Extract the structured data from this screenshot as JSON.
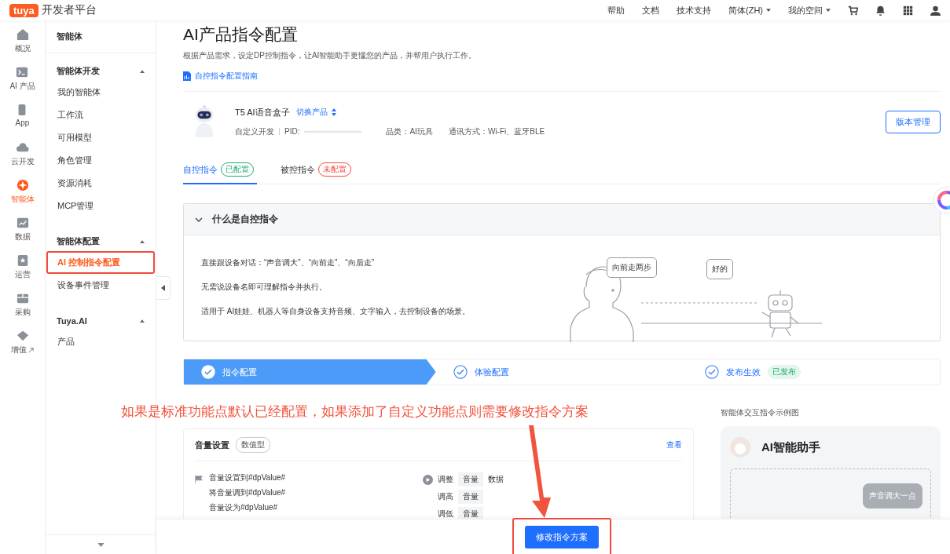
{
  "header": {
    "logo": "tuya",
    "title": "开发者平台",
    "links": [
      {
        "label": "帮助",
        "dropdown": false
      },
      {
        "label": "文档",
        "dropdown": false
      },
      {
        "label": "技术支持",
        "dropdown": false
      },
      {
        "label": "简体(ZH)",
        "dropdown": true
      },
      {
        "label": "我的空间",
        "dropdown": true
      }
    ]
  },
  "rail": [
    {
      "label": "概况",
      "selected": false,
      "external": false
    },
    {
      "label": "AI 产品",
      "selected": false,
      "external": false
    },
    {
      "label": "App",
      "selected": false,
      "external": false
    },
    {
      "label": "云开发",
      "selected": false,
      "external": false
    },
    {
      "label": "智能体",
      "selected": true,
      "external": false
    },
    {
      "label": "数据",
      "selected": false,
      "external": false
    },
    {
      "label": "运营",
      "selected": false,
      "external": false
    },
    {
      "label": "采购",
      "selected": false,
      "external": false
    },
    {
      "label": "增值",
      "selected": false,
      "external": true
    }
  ],
  "sidebar": {
    "title": "智能体",
    "groups": [
      {
        "label": "智能体开发",
        "expanded": true,
        "items": [
          {
            "label": "我的智能体",
            "selected": false,
            "highlighted": false
          },
          {
            "label": "工作流",
            "selected": false,
            "highlighted": false
          },
          {
            "label": "可用模型",
            "selected": false,
            "highlighted": false
          },
          {
            "label": "角色管理",
            "selected": false,
            "highlighted": false
          },
          {
            "label": "资源消耗",
            "selected": false,
            "highlighted": false
          },
          {
            "label": "MCP管理",
            "selected": false,
            "highlighted": false
          }
        ]
      },
      {
        "label": "智能体配置",
        "expanded": true,
        "items": [
          {
            "label": "AI 控制指令配置",
            "selected": true,
            "highlighted": true
          },
          {
            "label": "设备事件管理",
            "selected": false,
            "highlighted": false
          }
        ]
      },
      {
        "label": "Tuya.AI",
        "expanded": true,
        "items": [
          {
            "label": "产品",
            "selected": false,
            "highlighted": false
          }
        ]
      }
    ]
  },
  "page": {
    "title": "AI产品指令配置",
    "description": "根据产品需求，设定DP控制指令，让AI智能助手更懂您的产品，并帮用户执行工作。",
    "guide_link": "自控指令配置指南"
  },
  "product": {
    "name": "T5 AI语音盒子",
    "switch": "切换产品",
    "dev_type": "自定义开发",
    "pid_label": "PID:",
    "category": "品类：AI玩具",
    "connectivity": "通讯方式：Wi-Fi、蓝牙BLE",
    "version_button": "版本管理"
  },
  "tabs": [
    {
      "label": "自控指令",
      "selected": true,
      "badge": "已配置",
      "color": "#1fa971"
    },
    {
      "label": "被控指令",
      "selected": false,
      "badge": "未配置",
      "color": "#f04a3e"
    }
  ],
  "intro": {
    "title": "什么是自控指令",
    "expanded": true,
    "lines": [
      "直接跟设备对话：“声音调大”、“向前走”、“向后走”",
      "无需说设备名即可理解指令并执行。",
      "适用于 AI娃娃、机器人等自身设备支持音频、文字输入，去控制设备的场景。"
    ],
    "bubbles": [
      "向前走两步",
      "好的"
    ]
  },
  "steps": [
    {
      "label": "指令配置",
      "selected": true,
      "done": true
    },
    {
      "label": "体验配置",
      "selected": false,
      "done": true
    },
    {
      "label": "发布生效",
      "selected": false,
      "done": true,
      "badge": "已发布"
    }
  ],
  "command": {
    "name": "音量设置",
    "type": "数值型",
    "view": "查看",
    "phrases": [
      "音量设置到#dpValue#",
      "将音量调到#dpValue#",
      "音量设为#dpValue#"
    ],
    "actions": [
      {
        "verb": "调整",
        "param": "音量",
        "extra": "数据",
        "play": true
      },
      {
        "verb": "调高",
        "param": "音量",
        "play": false
      },
      {
        "verb": "调低",
        "param": "音量",
        "play": false
      }
    ]
  },
  "example": {
    "label": "智能体交互指令示例图",
    "assistant": "AI智能助手",
    "user_message": "声音调大一点"
  },
  "footer": {
    "button": "修改指令方案",
    "highlighted": true
  },
  "annotation": "如果是标准功能点默认已经配置，如果添加了自定义功能点则需要修改指令方案"
}
